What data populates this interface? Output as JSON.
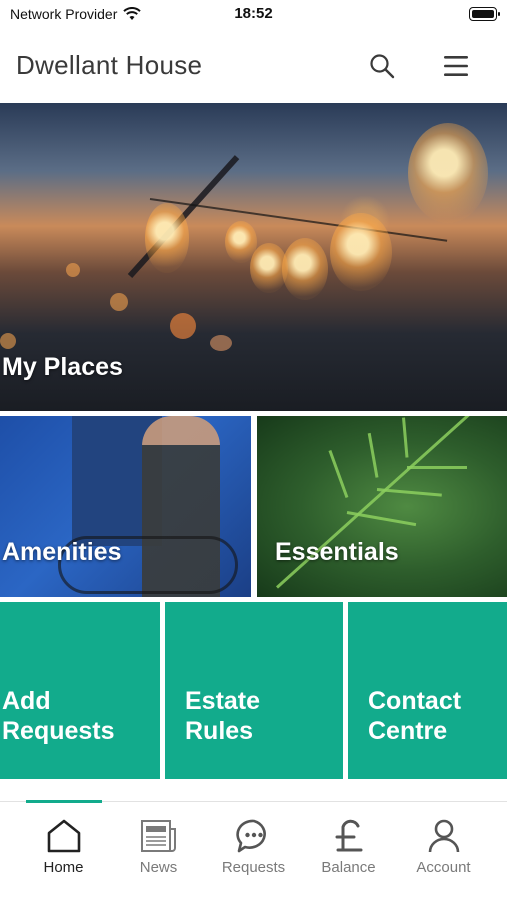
{
  "status_bar": {
    "carrier": "Network Provider",
    "time": "18:52",
    "wifi_icon": "wifi-icon",
    "battery_icon": "battery-icon"
  },
  "header": {
    "title": "Dwellant House",
    "search_icon": "search-icon",
    "menu_icon": "hamburger-menu-icon"
  },
  "tiles": {
    "my_places": "My Places",
    "amenities": "Amenities",
    "essentials": "Essentials",
    "add_requests": "Add\nRequests",
    "estate_rules": "Estate\nRules",
    "contact_centre": "Contact\nCentre"
  },
  "colors": {
    "accent": "#12ab8c",
    "title_text": "#3a3a3a",
    "tab_inactive": "#7a7a7a"
  },
  "tab_bar": {
    "active": "home",
    "items": [
      {
        "id": "home",
        "label": "Home",
        "icon": "home-icon"
      },
      {
        "id": "news",
        "label": "News",
        "icon": "newspaper-icon"
      },
      {
        "id": "requests",
        "label": "Requests",
        "icon": "chat-bubble-icon"
      },
      {
        "id": "balance",
        "label": "Balance",
        "icon": "pound-icon"
      },
      {
        "id": "account",
        "label": "Account",
        "icon": "person-icon"
      }
    ]
  }
}
